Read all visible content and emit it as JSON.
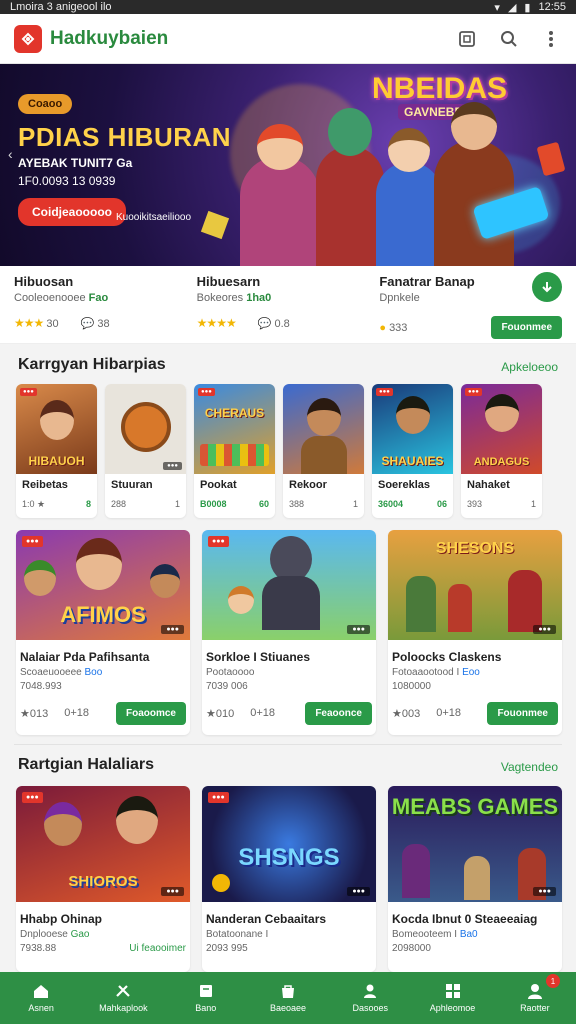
{
  "status_bar": {
    "left": "Lmoira 3 anigeool ilo",
    "time": "12:55"
  },
  "header": {
    "brand": "Hadkuybaien"
  },
  "hero": {
    "tag": "Coaoo",
    "title": "PDIAS HIBURAN",
    "subtitle": "AYEBAK TUNIT7 Ga",
    "date": "1F0.0093 13 0939",
    "cta": "Coidjeaooooo",
    "link": "Kuooikitsaeiliooo",
    "logo": "NBEIDAS",
    "logo_sub": "GAVNEBER"
  },
  "featured": [
    {
      "title": "Hibuosan",
      "sub": "Cooleoenooee",
      "tag": "Fao",
      "rating": "★★★",
      "rating_val": "30",
      "comments": "38"
    },
    {
      "title": "Hibuesarn",
      "sub": "Bokeores",
      "tag": "1ha0",
      "rating": "★★★★",
      "comments": "0.8"
    },
    {
      "title": "Fanatrar Banap",
      "sub": "Dpnkele",
      "coins": "333",
      "button": "Fouonmee"
    }
  ],
  "section1": {
    "title": "Karrgyan Hibarpias",
    "more": "Apkeloeoo"
  },
  "small_cards": [
    {
      "name": "Reibetas",
      "v1": "1:0 ★",
      "v2": "8",
      "art": "HIBAUOH"
    },
    {
      "name": "Stuuran",
      "v1": "288",
      "v2": "1",
      "art": ""
    },
    {
      "name": "Pookat",
      "v1": "B0008",
      "v2": "60",
      "art": "CHERAUS"
    },
    {
      "name": "Rekoor",
      "v1": "388",
      "v2": "1",
      "art": ""
    },
    {
      "name": "Soereklas",
      "v1": "36004",
      "v2": "06",
      "art": "SHAUAIES"
    },
    {
      "name": "Nahaket",
      "v1": "393",
      "v2": "1",
      "art": "ANDAGUS"
    }
  ],
  "big_cards_1": [
    {
      "name": "Nalaiar Pda Pafihsanta",
      "sub": "Scoaeuooeee",
      "tag": "Boo",
      "count": "7048.993",
      "v1": "★013",
      "v2": "0+18",
      "button": "Foaoomce",
      "art": "AFIMOS"
    },
    {
      "name": "Sorkloe I Stiuanes",
      "sub": "Pootaoooo",
      "tag": "",
      "count": "7039 006",
      "v1": "★010",
      "v2": "0+18",
      "button": "Feaoonce",
      "art": ""
    },
    {
      "name": "Poloocks Claskens",
      "sub": "Fotoaaootood I",
      "tag": "Eoo",
      "count": "1080000",
      "v1": "★003",
      "v2": "0+18",
      "button": "Fouonmee",
      "art": "SHESONS"
    }
  ],
  "section2": {
    "title": "Rartgian Halaliars",
    "more": "Vagtendeo"
  },
  "big_cards_2": [
    {
      "name": "Hhabp Ohinap",
      "sub": "Dnplooese",
      "tag": "Gao",
      "count": "7938.88",
      "extra": "Ui feaooimer",
      "art": "SHIOROS"
    },
    {
      "name": "Nanderan Cebaaitars",
      "sub": "Botatoonane I",
      "tag": "",
      "count": "2093 995",
      "art": "SHSNGS"
    },
    {
      "name": "Kocda Ibnut 0 Steaeeaiag",
      "sub": "Bomeooteem I",
      "tag": "Ba0",
      "count": "2098000",
      "art": "MEABS GAMES"
    }
  ],
  "bottom_nav": [
    "Asnen",
    "Mahkaplook",
    "Bano",
    "Baeoaee",
    "Dasooes",
    "Aphleomoe",
    "Raotter"
  ],
  "bottom_nav_badge": "1",
  "colors": {
    "green": "#2a9a48",
    "red": "#e2352b",
    "nav": "#2e8f45"
  }
}
